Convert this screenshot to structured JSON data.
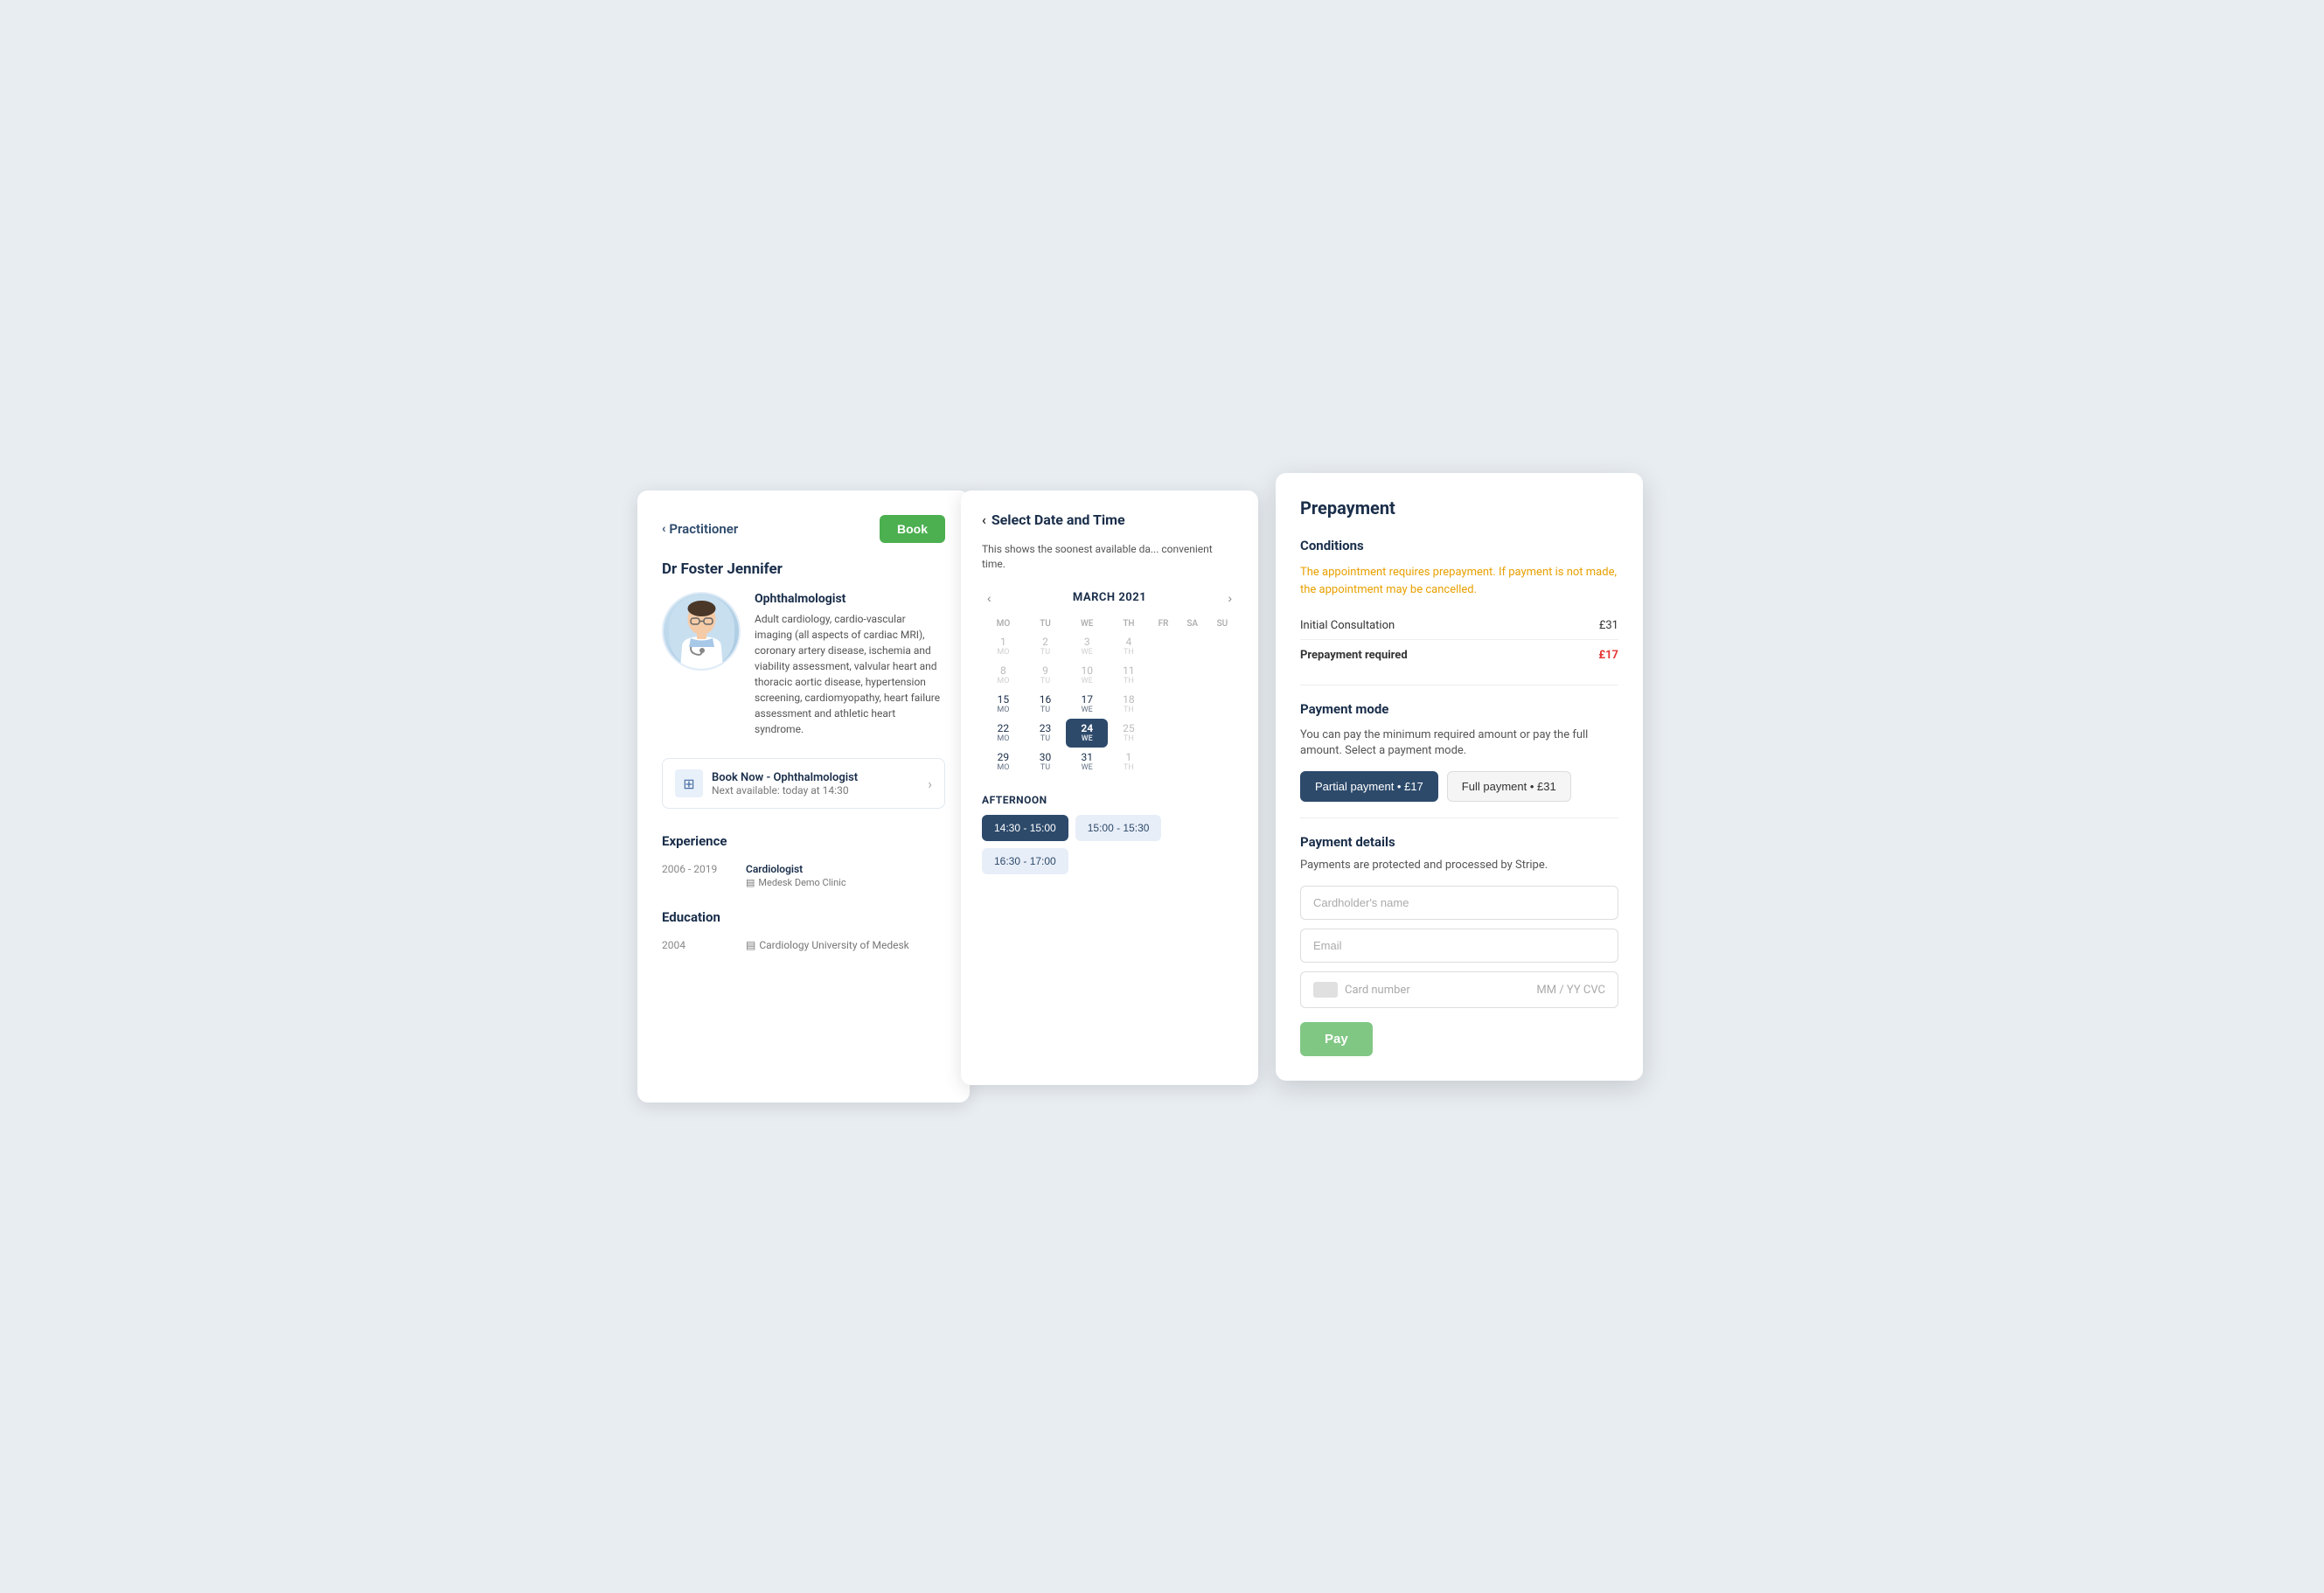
{
  "practitioner_panel": {
    "back_label": "Practitioner",
    "book_button": "Book",
    "doctor_name": "Dr Foster Jennifer",
    "specialty": "Ophthalmologist",
    "bio": "Adult cardiology, cardio-vascular imaging (all aspects of cardiac MRI), coronary artery disease, ischemia and viability assessment, valvular heart and thoracic aortic disease, hypertension screening, cardiomyopathy, heart failure assessment and athletic heart syndrome.",
    "booking_title": "Book Now - Ophthalmologist",
    "booking_subtitle": "Next available: today at 14:30",
    "experience_section": "Experience",
    "experience_items": [
      {
        "years": "2006 - 2019",
        "title": "Cardiologist",
        "clinic": "Medesk Demo Clinic"
      }
    ],
    "education_section": "Education",
    "education_items": [
      {
        "year": "2004",
        "institution": "Cardiology University of Medesk"
      }
    ]
  },
  "datetime_panel": {
    "back_label": "Select Date and Time",
    "subtitle": "This shows the soonest available da... convenient time.",
    "month": "MARCH 2021",
    "days_header": [
      "MO",
      "TU",
      "WE",
      "TH",
      "FR",
      "SA",
      "SU"
    ],
    "weeks": [
      [
        {
          "num": "1",
          "day": "MO",
          "active": false
        },
        {
          "num": "2",
          "day": "TU",
          "active": false
        },
        {
          "num": "3",
          "day": "WE",
          "active": false
        },
        {
          "num": "4",
          "day": "TH",
          "active": false
        },
        null,
        null,
        null
      ],
      [
        {
          "num": "8",
          "day": "MO",
          "active": false
        },
        {
          "num": "9",
          "day": "TU",
          "active": false
        },
        {
          "num": "10",
          "day": "WE",
          "active": false
        },
        {
          "num": "11",
          "day": "TH",
          "active": false
        },
        null,
        null,
        null
      ],
      [
        {
          "num": "15",
          "day": "MO",
          "active": true
        },
        {
          "num": "16",
          "day": "TU",
          "active": true
        },
        {
          "num": "17",
          "day": "WE",
          "active": true
        },
        {
          "num": "18",
          "day": "TH",
          "active": false
        },
        null,
        null,
        null
      ],
      [
        {
          "num": "22",
          "day": "MO",
          "active": true
        },
        {
          "num": "23",
          "day": "TU",
          "active": true
        },
        {
          "num": "24",
          "day": "WE",
          "active": true,
          "selected": true
        },
        {
          "num": "25",
          "day": "TH",
          "active": false
        },
        null,
        null,
        null
      ],
      [
        {
          "num": "29",
          "day": "MO",
          "active": true
        },
        {
          "num": "30",
          "day": "TU",
          "active": true
        },
        {
          "num": "31",
          "day": "WE",
          "active": true
        },
        {
          "num": "1",
          "day": "TH",
          "active": false
        },
        null,
        null,
        null
      ]
    ],
    "afternoon_title": "AFTERNOON",
    "time_slots": [
      {
        "label": "14:30 - 15:00",
        "selected": true
      },
      {
        "label": "15:00 - 15:30",
        "selected": false
      },
      {
        "label": "16:30 - 17:00",
        "selected": false
      }
    ]
  },
  "prepayment_panel": {
    "title": "Prepayment",
    "conditions_title": "Conditions",
    "warning_text": "The appointment requires prepayment. If payment is not made, the appointment may be cancelled.",
    "initial_consultation_label": "Initial Consultation",
    "initial_consultation_price": "£31",
    "prepayment_required_label": "Prepayment required",
    "prepayment_required_price": "£17",
    "payment_mode_title": "Payment mode",
    "payment_mode_desc": "You can pay the minimum required amount or pay the full amount. Select a payment mode.",
    "partial_payment_label": "Partial payment • £17",
    "full_payment_label": "Full payment • £31",
    "payment_details_title": "Payment details",
    "payment_details_desc": "Payments are protected and processed by Stripe.",
    "cardholder_placeholder": "Cardholder's name",
    "email_placeholder": "Email",
    "card_number_placeholder": "Card number",
    "card_expiry_placeholder": "MM / YY  CVC",
    "pay_button": "Pay"
  }
}
